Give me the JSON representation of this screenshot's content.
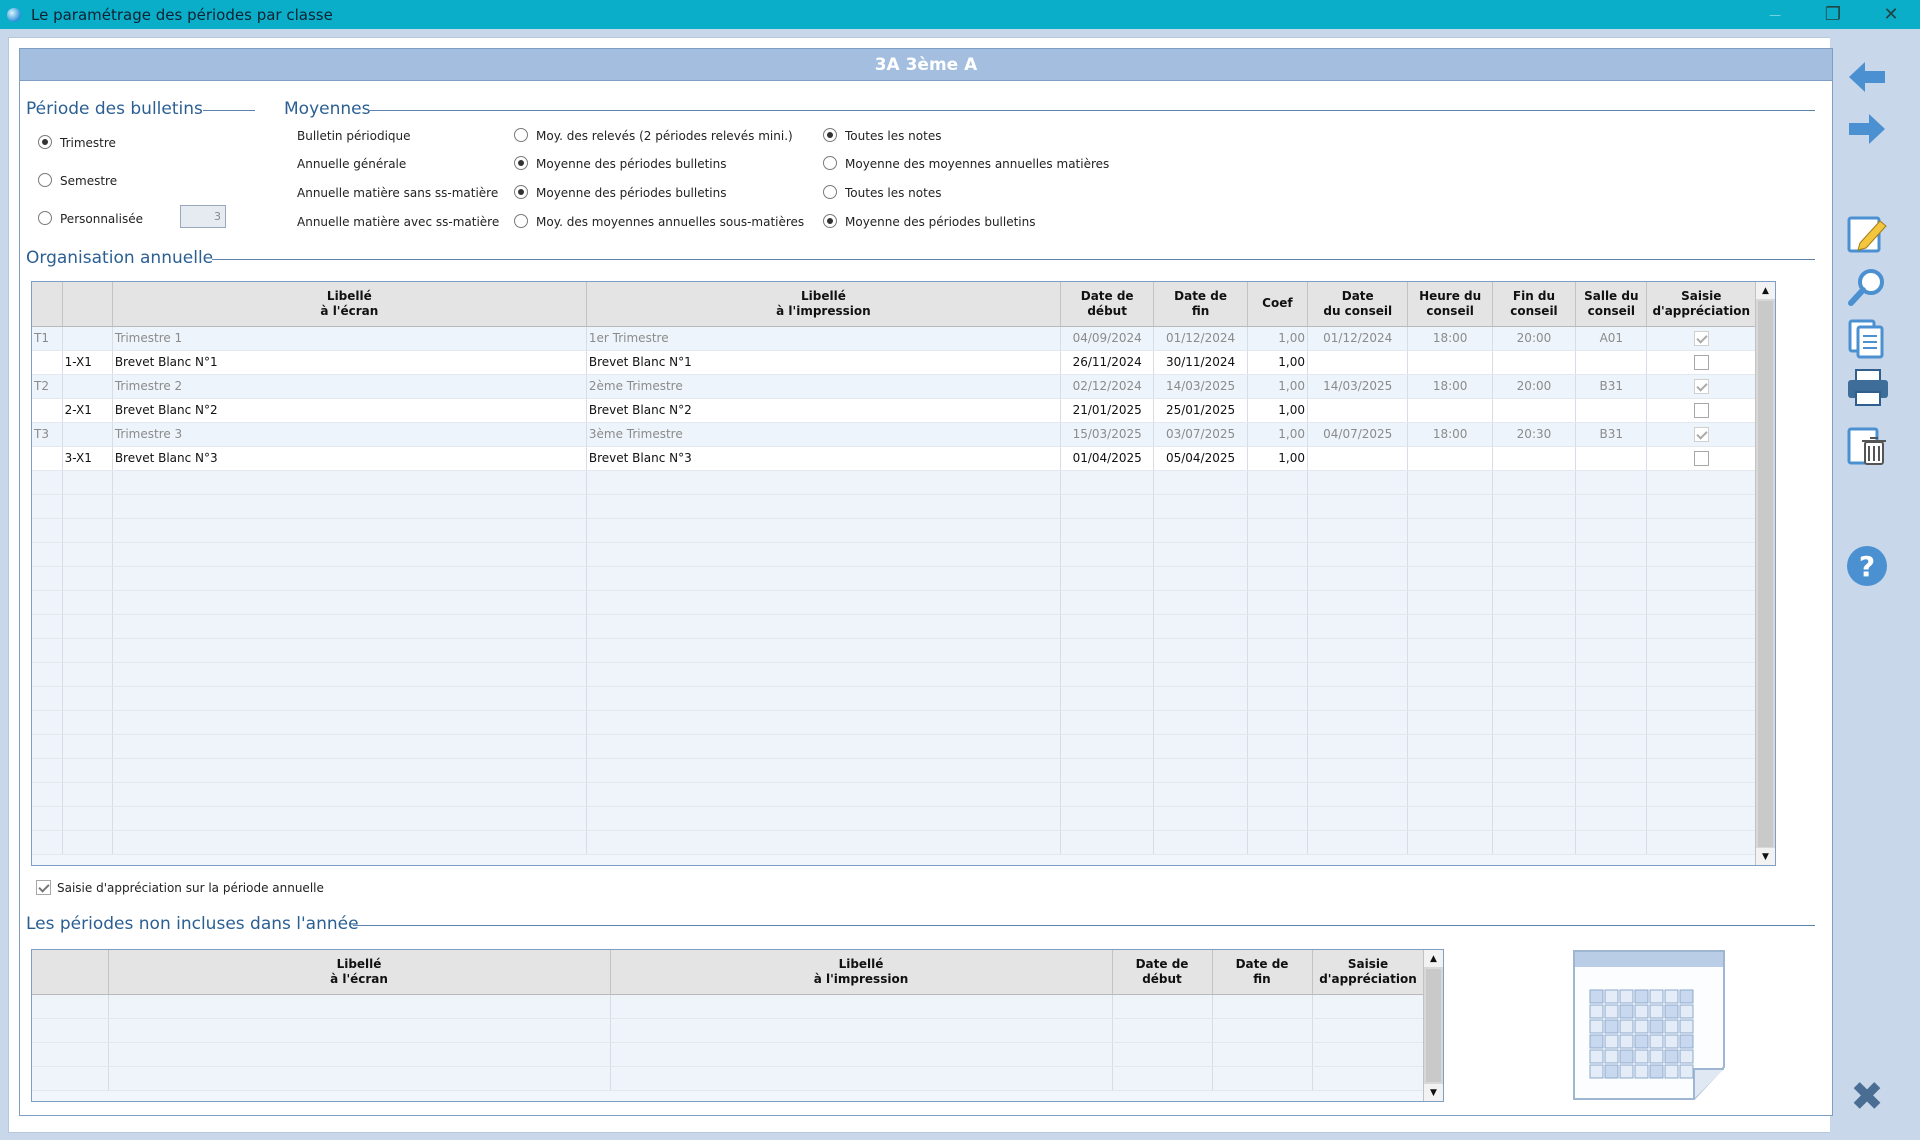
{
  "window": {
    "title": "Le paramétrage des périodes par classe",
    "minimize": "—",
    "restore": "❐",
    "close": "✕"
  },
  "header": {
    "class_title": "3A 3ème A"
  },
  "periode": {
    "title": "Période des bulletins",
    "options": [
      {
        "label": "Trimestre",
        "selected": true
      },
      {
        "label": "Semestre",
        "selected": false
      },
      {
        "label": "Personnalisée",
        "selected": false
      }
    ],
    "custom_value": "3"
  },
  "moyennes": {
    "title": "Moyennes",
    "rows": [
      {
        "label": "Bulletin périodique",
        "opt1": "Moy. des relevés (2 périodes relevés mini.)",
        "opt1_selected": false,
        "opt2": "Toutes les notes",
        "opt2_selected": true
      },
      {
        "label": "Annuelle générale",
        "opt1": "Moyenne des périodes bulletins",
        "opt1_selected": true,
        "opt2": "Moyenne des moyennes annuelles matières",
        "opt2_selected": false
      },
      {
        "label": "Annuelle matière sans ss-matière",
        "opt1": "Moyenne des périodes bulletins",
        "opt1_selected": true,
        "opt2": "Toutes les notes",
        "opt2_selected": false
      },
      {
        "label": "Annuelle matière avec ss-matière",
        "opt1": "Moy. des moyennes annuelles sous-matières",
        "opt1_selected": false,
        "opt2": "Moyenne des périodes bulletins",
        "opt2_selected": true
      }
    ]
  },
  "organisation": {
    "title": "Organisation annuelle",
    "columns": {
      "libelle_ecran": [
        "Libellé",
        "à l'écran"
      ],
      "libelle_impression": [
        "Libellé",
        "à l'impression"
      ],
      "date_debut": [
        "Date de",
        "début"
      ],
      "date_fin": [
        "Date de",
        "fin"
      ],
      "coef": "Coef",
      "date_conseil": [
        "Date",
        "du conseil"
      ],
      "heure_conseil": [
        "Heure du",
        "conseil"
      ],
      "fin_conseil": [
        "Fin du",
        "conseil"
      ],
      "salle_conseil": [
        "Salle du",
        "conseil"
      ],
      "saisie": [
        "Saisie",
        "d'appréciation"
      ]
    },
    "rows": [
      {
        "code": "T1",
        "sub": "",
        "ecran": "Trimestre 1",
        "impression": "1er Trimestre",
        "debut": "04/09/2024",
        "fin": "01/12/2024",
        "coef": "1,00",
        "date_conseil": "01/12/2024",
        "heure": "18:00",
        "fin_conseil": "20:00",
        "salle": "A01",
        "saisie": true,
        "period": true
      },
      {
        "code": "",
        "sub": "1-X1",
        "ecran": "Brevet Blanc N°1",
        "impression": "Brevet Blanc N°1",
        "debut": "26/11/2024",
        "fin": "30/11/2024",
        "coef": "1,00",
        "date_conseil": "",
        "heure": "",
        "fin_conseil": "",
        "salle": "",
        "saisie": false,
        "period": false
      },
      {
        "code": "T2",
        "sub": "",
        "ecran": "Trimestre 2",
        "impression": "2ème Trimestre",
        "debut": "02/12/2024",
        "fin": "14/03/2025",
        "coef": "1,00",
        "date_conseil": "14/03/2025",
        "heure": "18:00",
        "fin_conseil": "20:00",
        "salle": "B31",
        "saisie": true,
        "period": true
      },
      {
        "code": "",
        "sub": "2-X1",
        "ecran": "Brevet Blanc N°2",
        "impression": "Brevet Blanc N°2",
        "debut": "21/01/2025",
        "fin": "25/01/2025",
        "coef": "1,00",
        "date_conseil": "",
        "heure": "",
        "fin_conseil": "",
        "salle": "",
        "saisie": false,
        "period": false
      },
      {
        "code": "T3",
        "sub": "",
        "ecran": "Trimestre 3",
        "impression": "3ème Trimestre",
        "debut": "15/03/2025",
        "fin": "03/07/2025",
        "coef": "1,00",
        "date_conseil": "04/07/2025",
        "heure": "18:00",
        "fin_conseil": "20:30",
        "salle": "B31",
        "saisie": true,
        "period": true
      },
      {
        "code": "",
        "sub": "3-X1",
        "ecran": "Brevet Blanc N°3",
        "impression": "Brevet Blanc N°3",
        "debut": "01/04/2025",
        "fin": "05/04/2025",
        "coef": "1,00",
        "date_conseil": "",
        "heure": "",
        "fin_conseil": "",
        "salle": "",
        "saisie": false,
        "period": false
      }
    ]
  },
  "annual_appreciation": {
    "label": "Saisie d'appréciation sur la période annuelle",
    "checked": true
  },
  "non_incluses": {
    "title": "Les périodes non incluses dans l'année",
    "columns": {
      "libelle_ecran": [
        "Libellé",
        "à l'écran"
      ],
      "libelle_impression": [
        "Libellé",
        "à l'impression"
      ],
      "date_debut": [
        "Date de",
        "début"
      ],
      "date_fin": [
        "Date de",
        "fin"
      ],
      "saisie": [
        "Saisie",
        "d'appréciation"
      ]
    }
  },
  "scroll": {
    "up": "▲",
    "down": "▼"
  },
  "toolbar": {
    "icons": [
      "arrow-left-icon",
      "arrow-right-icon",
      "edit-icon",
      "search-icon",
      "copy-icon",
      "print-icon",
      "delete-icon",
      "help-icon",
      "close-icon"
    ],
    "help_glyph": "?",
    "close_glyph": "✖"
  },
  "colors": {
    "titlebar": "#0aaec8",
    "header": "#a3bede",
    "section": "#2b5f93",
    "accent_icon": "#4b90d0"
  }
}
